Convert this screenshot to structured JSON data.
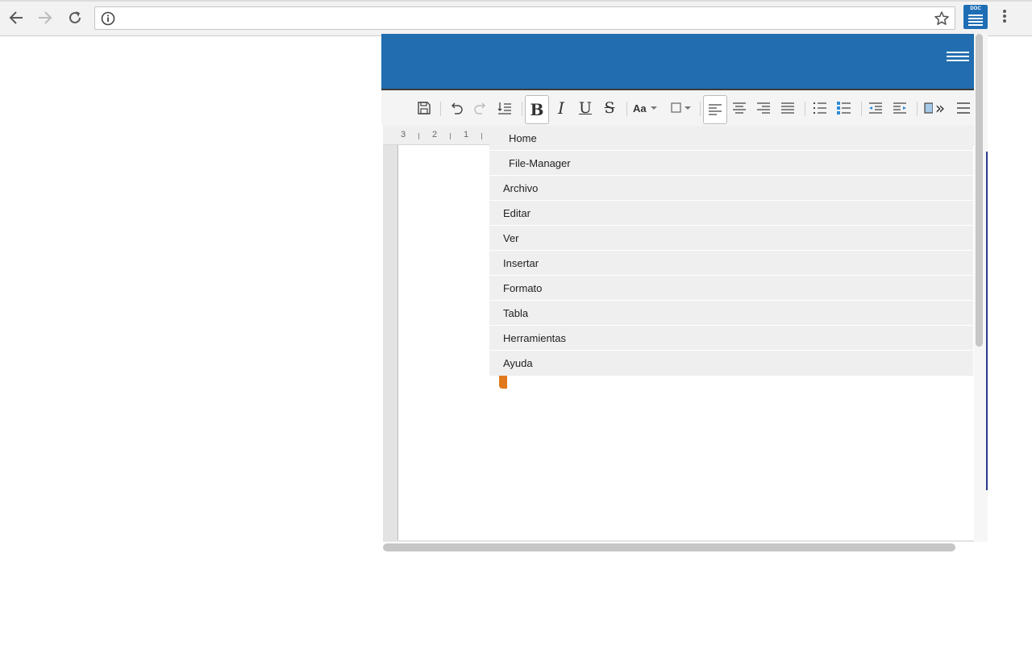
{
  "browser": {
    "address_text": "",
    "extension_label": "DOC"
  },
  "ruler": {
    "ticks": [
      "3",
      "2",
      "1"
    ]
  },
  "menu": {
    "items": [
      {
        "label": "Home"
      },
      {
        "label": "File-Manager"
      },
      {
        "label": "Archivo"
      },
      {
        "label": "Editar"
      },
      {
        "label": "Ver"
      },
      {
        "label": "Insertar"
      },
      {
        "label": "Formato"
      },
      {
        "label": "Tabla"
      },
      {
        "label": "Herramientas"
      },
      {
        "label": "Ayuda"
      }
    ]
  },
  "toolbar": {
    "bold_label": "B",
    "italic_label": "I",
    "underline_label": "U",
    "strike_label": "S",
    "font_size_label": "Aa",
    "overflow_label": "»"
  },
  "colors": {
    "header_blue": "#216daf",
    "accent_orange": "#e2781c"
  }
}
